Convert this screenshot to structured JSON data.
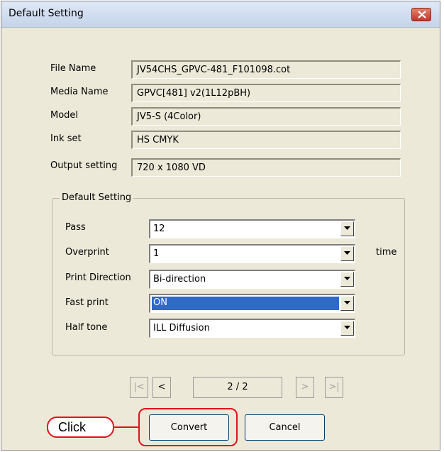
{
  "window": {
    "title": "Default Setting"
  },
  "info": [
    {
      "label": "File Name",
      "value": "JV54CHS_GPVC-481_F101098.cot"
    },
    {
      "label": "Media Name",
      "value": "GPVC[481] v2(1L12pBH)"
    },
    {
      "label": "Model",
      "value": "JV5-S (4Color)"
    },
    {
      "label": "Ink set",
      "value": "HS CMYK"
    },
    {
      "label": "Output setting",
      "value": "720 x 1080 VD"
    }
  ],
  "group": {
    "title": "Default Setting",
    "rows": [
      {
        "label": "Pass",
        "value": "12"
      },
      {
        "label": "Overprint",
        "value": "1"
      },
      {
        "label": "Print Direction",
        "value": "Bi-direction"
      },
      {
        "label": "Fast print",
        "value": "ON"
      },
      {
        "label": "Half tone",
        "value": "ILL Diffusion"
      }
    ],
    "overprint_unit": "time"
  },
  "pager": {
    "first": "|<",
    "prev": "<",
    "page": "2 / 2",
    "next": ">",
    "last": ">|"
  },
  "buttons": {
    "convert": "Convert",
    "cancel": "Cancel"
  },
  "annotation": {
    "callout": "Click",
    "color": "#e0121c"
  }
}
